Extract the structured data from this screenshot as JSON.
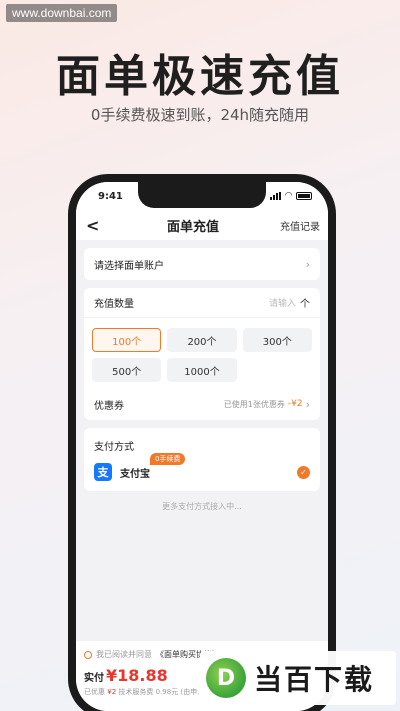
{
  "watermark": {
    "site": "www.downbai.com",
    "brand": "当百下载"
  },
  "promo": {
    "headline": "面单极速充值",
    "subline": "0手续费极速到账，24h随充随用"
  },
  "status_bar": {
    "time": "9:41"
  },
  "nav": {
    "back_label": "<",
    "title": "面单充值",
    "right_link": "充值记录"
  },
  "account_select": {
    "label": "请选择面单账户"
  },
  "quantity": {
    "label": "充值数量",
    "placeholder": "请输入",
    "unit": "个",
    "options": [
      {
        "label": "100个",
        "selected": true
      },
      {
        "label": "200个",
        "selected": false
      },
      {
        "label": "300个",
        "selected": false
      },
      {
        "label": "500个",
        "selected": false
      },
      {
        "label": "1000个",
        "selected": false
      }
    ]
  },
  "coupon": {
    "label": "优惠券",
    "status": "已使用1张优惠券",
    "discount": "-¥2"
  },
  "payment": {
    "label": "支付方式",
    "method": "支付宝",
    "method_icon": "alipay-icon",
    "fee_badge": "0手续费",
    "more_text": "更多支付方式接入中..."
  },
  "bottom": {
    "agree_text": "我已阅读并同意",
    "agree_link": "《面单购买协议》",
    "pay_label": "实付",
    "amount": "¥18.88",
    "saved_label": "已优惠",
    "saved_value": "¥2",
    "fee_text": "技术服务费 0.98元 (由申..."
  },
  "colors": {
    "accent": "#f07a2a",
    "price": "#e8352e",
    "alipay": "#1677ff"
  }
}
